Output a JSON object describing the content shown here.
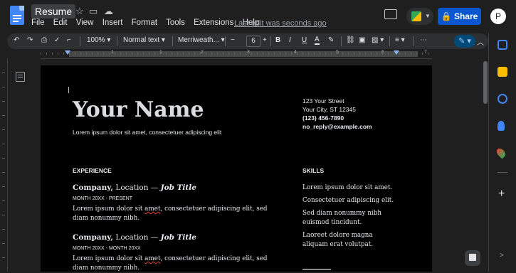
{
  "app": {
    "title": "Resume",
    "menu": [
      "File",
      "Edit",
      "View",
      "Insert",
      "Format",
      "Tools",
      "Extensions",
      "Help"
    ],
    "last_edit": "Last edit was seconds ago",
    "share_label": "Share",
    "avatar_letter": "P"
  },
  "toolbar": {
    "zoom": "100%",
    "style": "Normal text",
    "font": "Merriweath...",
    "font_size": "6",
    "minus": "−",
    "plus": "+",
    "bold": "B",
    "italic": "I",
    "underline": "U",
    "text_color": "A",
    "more": "⋯",
    "edit_mode": "✎"
  },
  "ruler": {
    "numbers": [
      "1",
      "1",
      "2",
      "3",
      "4",
      "5",
      "6",
      "7"
    ]
  },
  "resume": {
    "name": "Your Name",
    "subtitle": "Lorem ipsum dolor sit amet, consectetuer adipiscing elit",
    "address1": "123 Your Street",
    "address2": "Your City, ST 12345",
    "phone": "(123) 456-7890",
    "email": "no_reply@example.com",
    "experience_heading": "EXPERIENCE",
    "skills_heading": "SKILLS",
    "jobs": [
      {
        "company": "Company,",
        "location": "Location —",
        "title": "Job Title",
        "dates": "MONTH 20XX - PRESENT",
        "desc_a": "Lorem ipsum dolor sit ",
        "desc_b": "amet",
        "desc_c": ", consectetuer adipiscing elit, sed diam nonummy nibh."
      },
      {
        "company": "Company,",
        "location": "Location —",
        "title": "Job Title",
        "dates": "MONTH 20XX - MONTH 20XX",
        "desc_a": "Lorem ipsum dolor sit ",
        "desc_b": "amet",
        "desc_c": ", consectetuer adipiscing elit, sed diam nonummy nibh."
      }
    ],
    "skills": [
      "Lorem ipsum dolor sit amet.",
      "Consectetuer adipiscing elit.",
      "Sed diam nonummy nibh euismod tincidunt.",
      "Laoreet dolore magna aliquam erat volutpat."
    ]
  },
  "colors": {
    "accent": "#0b57d0",
    "docs_blue": "#4285f4",
    "page": "#000000"
  }
}
